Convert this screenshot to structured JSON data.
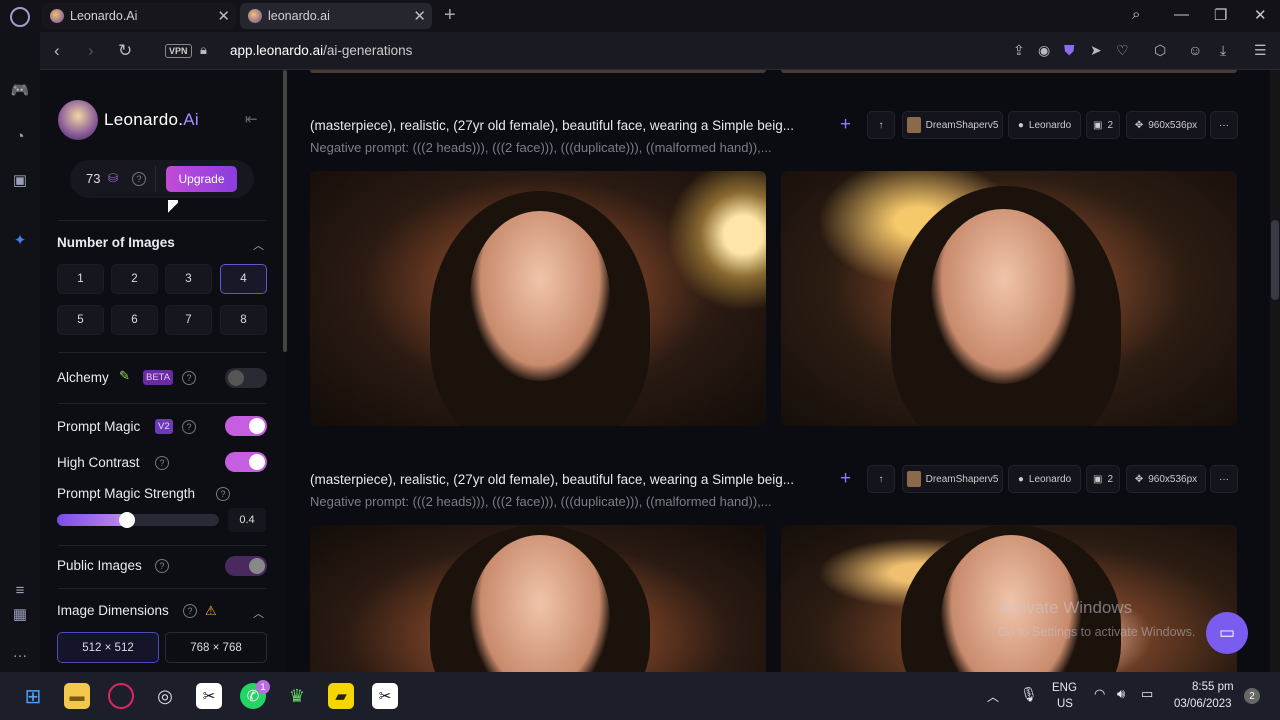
{
  "browser": {
    "tabs": [
      {
        "label": "Leonardo.Ai"
      },
      {
        "label": "leonardo.ai"
      }
    ],
    "url_domain": "app.leonardo.ai",
    "url_path": "/ai-generations",
    "vpn_label": "VPN"
  },
  "panel": {
    "brand_name": "Leonardo.",
    "brand_suffix": "Ai",
    "credits": "73",
    "upgrade_label": "Upgrade",
    "number_of_images_title": "Number of Images",
    "number_options": [
      "1",
      "2",
      "3",
      "4",
      "5",
      "6",
      "7",
      "8"
    ],
    "selected_number": "4",
    "alchemy_label": "Alchemy",
    "alchemy_badge": "BETA",
    "prompt_magic_label": "Prompt Magic",
    "prompt_magic_badge": "V2",
    "high_contrast_label": "High Contrast",
    "prompt_magic_strength_label": "Prompt Magic Strength",
    "prompt_magic_strength_value": "0.4",
    "public_images_label": "Public Images",
    "image_dimensions_title": "Image Dimensions",
    "dimension_options": [
      "512 × 512",
      "768 × 768"
    ],
    "selected_dimension": "512 × 512"
  },
  "generations": [
    {
      "prompt": "(masterpiece), realistic, (27yr old female), beautiful face, wearing a Simple beig...",
      "negative": "Negative prompt: (((2 heads))), (((2 face))), (((duplicate))), ((malformed hand)),...",
      "model": "DreamShaperv5",
      "style": "Leonardo",
      "count": "2",
      "size": "960x536px"
    },
    {
      "prompt": "(masterpiece), realistic, (27yr old female), beautiful face, wearing a Simple beig...",
      "negative": "Negative prompt: (((2 heads))), (((2 face))), (((duplicate))), ((malformed hand)),...",
      "model": "DreamShaperv5",
      "style": "Leonardo",
      "count": "2",
      "size": "960x536px"
    }
  ],
  "overlay": {
    "activate_title": "Activate Windows",
    "activate_sub": "Go to Settings to activate Windows."
  },
  "taskbar": {
    "lang_top": "ENG",
    "lang_bottom": "US",
    "time": "8:55 pm",
    "date": "03/06/2023",
    "notif_count": "2",
    "whatsapp_badge": "1"
  }
}
